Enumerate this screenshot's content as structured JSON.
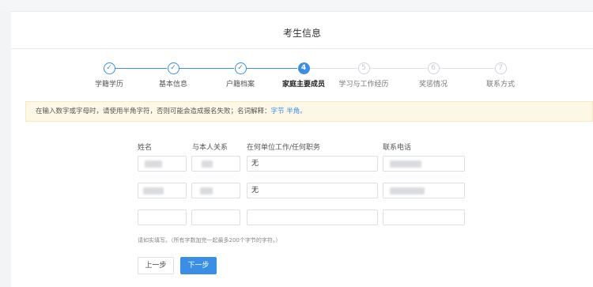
{
  "header": {
    "title": "考生信息"
  },
  "steps": [
    {
      "label": "学籍学历",
      "state": "done",
      "marker": "✓"
    },
    {
      "label": "基本信息",
      "state": "done",
      "marker": "✓"
    },
    {
      "label": "户籍档案",
      "state": "done",
      "marker": "✓"
    },
    {
      "label": "家庭主要成员",
      "state": "active",
      "marker": "4"
    },
    {
      "label": "学习与工作经历",
      "state": "todo",
      "marker": "5"
    },
    {
      "label": "奖惩情况",
      "state": "todo",
      "marker": "6"
    },
    {
      "label": "联系方式",
      "state": "todo",
      "marker": "7"
    }
  ],
  "notice": {
    "text": "在输入数字或字母时，请使用半角字符，否则可能会造成报名失败；名词解释：",
    "link_1": "字节",
    "link_2": "半角。"
  },
  "table": {
    "headers": [
      "姓名",
      "与本人关系",
      "在何单位工作/任何职务",
      "联系电话"
    ],
    "rows": [
      {
        "name": "",
        "relation": "",
        "work": "无",
        "phone": ""
      },
      {
        "name": "",
        "relation": "",
        "work": "无",
        "phone": ""
      },
      {
        "name": "",
        "relation": "",
        "work": "",
        "phone": ""
      }
    ]
  },
  "hint": "请如实填写。（所有字数加完一起最多200个字节的字符。）",
  "buttons": {
    "prev": "上一步",
    "next": "下一步"
  },
  "colors": {
    "accent": "#3a8ee6",
    "notice_bg": "#fdf8e6"
  }
}
